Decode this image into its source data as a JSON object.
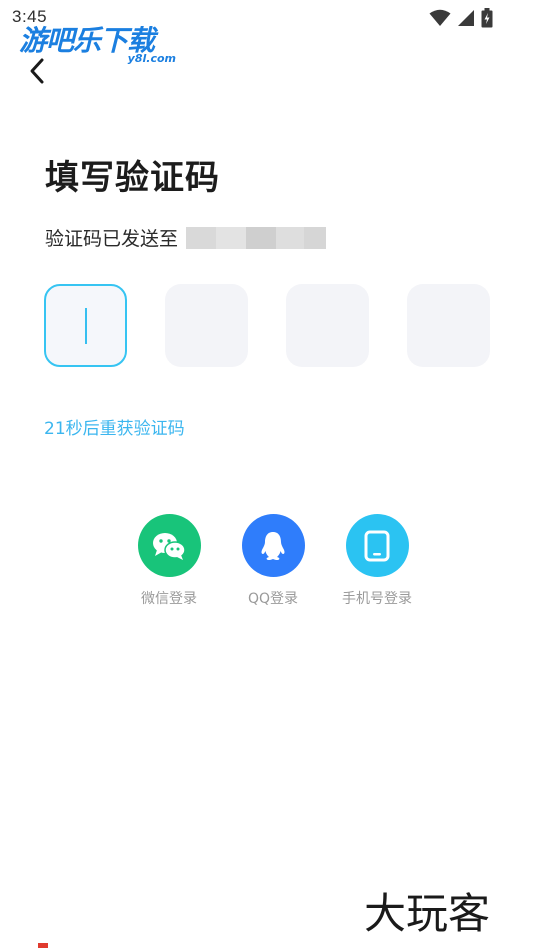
{
  "status_bar": {
    "time": "3:45",
    "icons": [
      "wifi-icon",
      "cell-signal-icon",
      "battery-icon"
    ]
  },
  "watermark": {
    "title": "游吧乐下载",
    "subtitle": "y8l.com"
  },
  "header": {
    "back_icon": "chevron-left-icon"
  },
  "page": {
    "title": "填写验证码",
    "sent_label": "验证码已发送至"
  },
  "code_inputs": {
    "count": 4,
    "values": [
      "",
      "",
      "",
      ""
    ],
    "active_index": 0
  },
  "resend": {
    "label": "21秒后重获验证码"
  },
  "login_options": [
    {
      "label": "微信登录",
      "icon": "wechat-icon",
      "color": "#18c47a"
    },
    {
      "label": "QQ登录",
      "icon": "qq-penguin-icon",
      "color": "#2f7dfb"
    },
    {
      "label": "手机号登录",
      "icon": "phone-icon",
      "color": "#2bc3f2"
    }
  ],
  "bottom_watermark": {
    "text": "大玩客"
  },
  "colors": {
    "accent": "#36c4f2",
    "link": "#3bb6ef",
    "box_bg": "#f3f4f8"
  }
}
